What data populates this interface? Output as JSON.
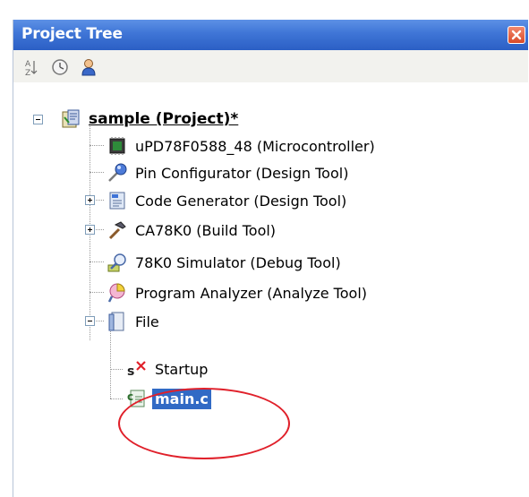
{
  "window": {
    "title": "Project Tree"
  },
  "toolbar": {
    "buttons": [
      {
        "icon": "sort-az-icon"
      },
      {
        "icon": "clock-icon"
      },
      {
        "icon": "user-icon"
      }
    ]
  },
  "tree": {
    "project": "sample (Project)*",
    "items": [
      {
        "label": "uPD78F0588_48 (Microcontroller)",
        "icon": "microcontroller-icon"
      },
      {
        "label": "Pin Configurator (Design Tool)",
        "icon": "pin-configurator-icon"
      },
      {
        "label": "Code Generator (Design Tool)",
        "icon": "code-generator-icon"
      },
      {
        "label": "CA78K0 (Build Tool)",
        "icon": "hammer-icon"
      },
      {
        "label": "78K0 Simulator (Debug Tool)",
        "icon": "simulator-icon"
      },
      {
        "label": "Program Analyzer (Analyze Tool)",
        "icon": "analyzer-icon"
      },
      {
        "label": "File",
        "icon": "folder-icon"
      }
    ],
    "file_children": [
      {
        "label": "Startup",
        "icon": "startup-icon"
      },
      {
        "label": "main.c",
        "icon": "c-file-icon",
        "selected": true
      }
    ]
  },
  "colors": {
    "titlebar": "#3f75d6",
    "selection": "#316ac5",
    "highlight_ellipse": "#e0202a"
  }
}
